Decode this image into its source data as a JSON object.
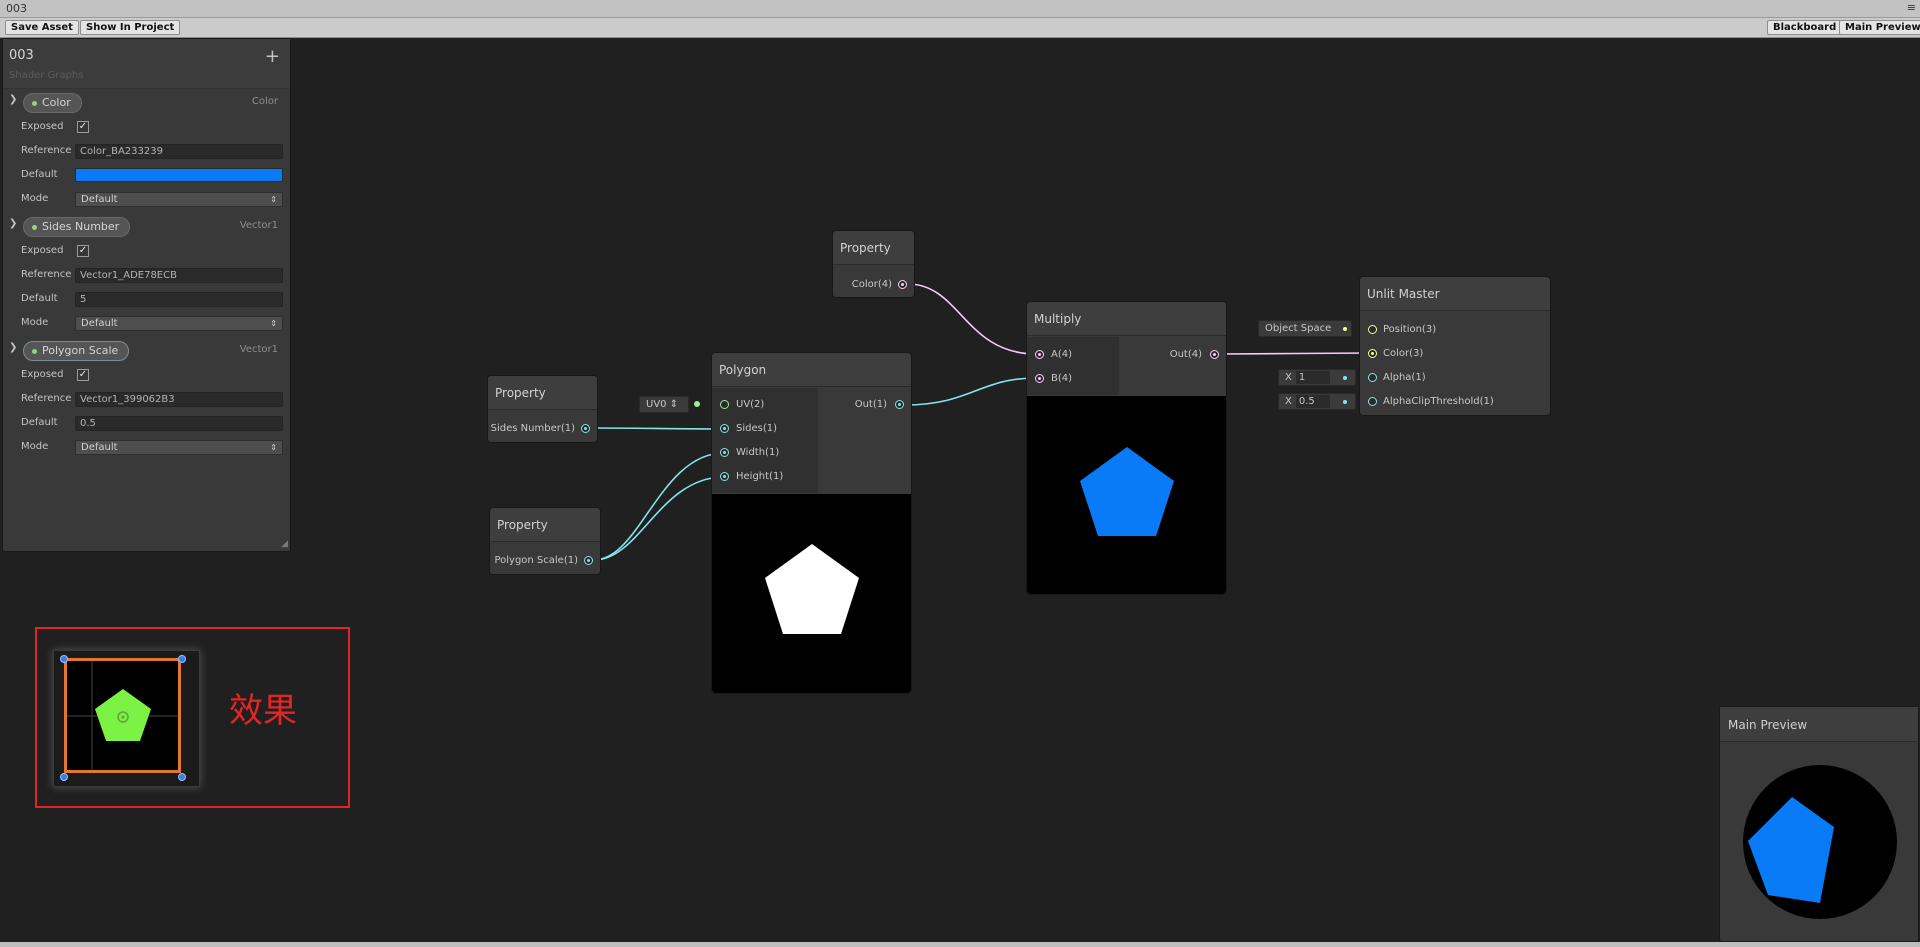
{
  "window": {
    "title": "003",
    "menu_icon": "≡"
  },
  "toolbar": {
    "save_asset": "Save Asset",
    "show_in_project": "Show In Project",
    "blackboard": "Blackboard",
    "main_preview": "Main Preview"
  },
  "blackboard": {
    "title": "003",
    "subtitle": "Shader Graphs",
    "add": "+",
    "properties": [
      {
        "name": "Color",
        "type": "Color",
        "fields": {
          "exposed_label": "Exposed",
          "reference_label": "Reference",
          "reference": "Color_BA233239",
          "default_label": "Default",
          "default_color": "#0a7bf7",
          "mode_label": "Mode",
          "mode": "Default"
        }
      },
      {
        "name": "Sides Number",
        "type": "Vector1",
        "fields": {
          "exposed_label": "Exposed",
          "reference_label": "Reference",
          "reference": "Vector1_ADE78ECB",
          "default_label": "Default",
          "default": "5",
          "mode_label": "Mode",
          "mode": "Default"
        }
      },
      {
        "name": "Polygon Scale",
        "type": "Vector1",
        "fields": {
          "exposed_label": "Exposed",
          "reference_label": "Reference",
          "reference": "Vector1_399062B3",
          "default_label": "Default",
          "default": "0.5",
          "mode_label": "Mode",
          "mode": "Default"
        }
      }
    ]
  },
  "nodes": {
    "prop_color": {
      "title": "Property",
      "out": "Color(4)"
    },
    "prop_sides": {
      "title": "Property",
      "out": "Sides Number(1)"
    },
    "prop_scale": {
      "title": "Property",
      "out": "Polygon Scale(1)"
    },
    "polygon": {
      "title": "Polygon",
      "uv_slot": "UV0",
      "inputs": [
        "UV(2)",
        "Sides(1)",
        "Width(1)",
        "Height(1)"
      ],
      "out": "Out(1)"
    },
    "multiply": {
      "title": "Multiply",
      "inputs": [
        "A(4)",
        "B(4)"
      ],
      "out": "Out(4)"
    },
    "unlit": {
      "title": "Unlit Master",
      "inputs": [
        "Position(3)",
        "Color(3)",
        "Alpha(1)",
        "AlphaClipThreshold(1)"
      ],
      "slots": {
        "space": "Object Space",
        "x_label": "X",
        "alpha": "1",
        "clip": "0.5"
      }
    }
  },
  "effect": {
    "label": "效果"
  },
  "main_preview": {
    "title": "Main Preview"
  },
  "colors": {
    "polygon_blue": "#0a7bf7",
    "sprite_green": "#7cf244",
    "effect_red": "#e32525",
    "frame_orange": "#e4772e"
  }
}
